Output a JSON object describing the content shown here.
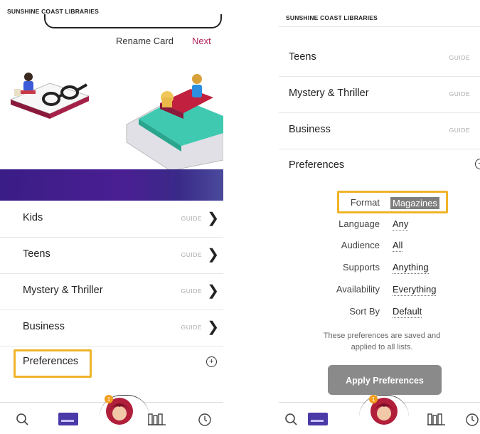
{
  "left": {
    "brand": "SUNSHINE COAST LIBRARIES",
    "actions": {
      "rename": "Rename Card",
      "next": "Next"
    },
    "lists": [
      {
        "label": "Kids",
        "guide": "GUIDE"
      },
      {
        "label": "Teens",
        "guide": "GUIDE"
      },
      {
        "label": "Mystery & Thriller",
        "guide": "GUIDE"
      },
      {
        "label": "Business",
        "guide": "GUIDE"
      }
    ],
    "preferences": "Preferences"
  },
  "right": {
    "brand": "SUNSHINE COAST LIBRARIES",
    "lists": [
      {
        "label": "Teens",
        "guide": "GUIDE"
      },
      {
        "label": "Mystery & Thriller",
        "guide": "GUIDE"
      },
      {
        "label": "Business",
        "guide": "GUIDE"
      }
    ],
    "preferences": "Preferences",
    "form": [
      {
        "key": "Format",
        "value": "Magazines"
      },
      {
        "key": "Language",
        "value": "Any"
      },
      {
        "key": "Audience",
        "value": "All"
      },
      {
        "key": "Supports",
        "value": "Anything"
      },
      {
        "key": "Availability",
        "value": "Everything"
      },
      {
        "key": "Sort By",
        "value": "Default"
      }
    ],
    "note_line1": "These preferences are saved and",
    "note_line2": "applied to all lists.",
    "apply": "Apply Preferences"
  },
  "nav": {
    "badge": "1"
  },
  "colors": {
    "accent": "#b0245a",
    "highlight": "#f0b429",
    "band": "#3a1d86",
    "button": "#8a8a8a"
  },
  "icons": [
    "search-icon",
    "library-card-icon",
    "profile-avatar-icon",
    "shelf-icon",
    "clock-icon",
    "add-circle-icon",
    "chevron-right-icon"
  ]
}
